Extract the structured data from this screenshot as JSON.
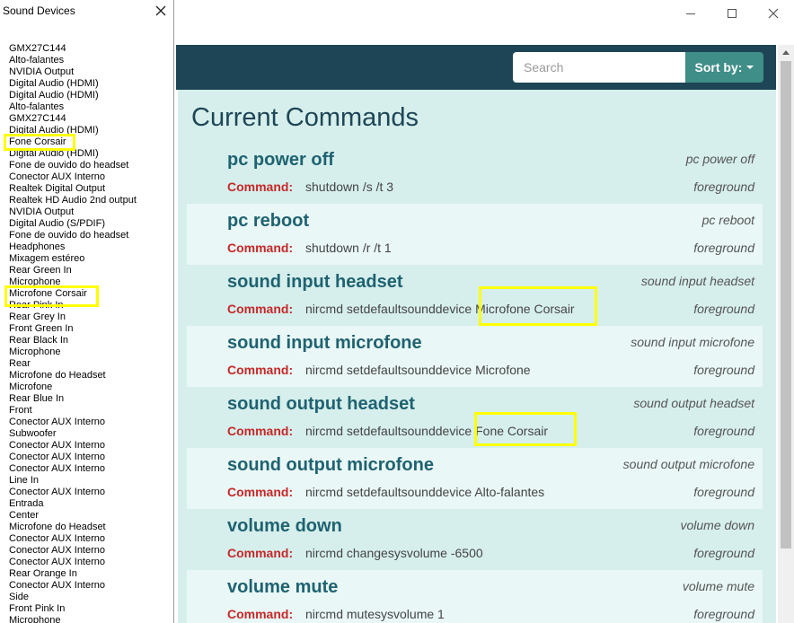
{
  "sound_panel": {
    "title": "Sound Devices",
    "devices": [
      "GMX27C144",
      "Alto-falantes",
      "NVIDIA Output",
      "Digital Audio (HDMI)",
      "Digital Audio (HDMI)",
      "Alto-falantes",
      "GMX27C144",
      "Digital Audio (HDMI)",
      "Fone Corsair",
      "Digital Audio (HDMI)",
      "Fone de ouvido do headset",
      "Conector AUX Interno",
      "Realtek Digital Output",
      "Realtek HD Audio 2nd output",
      "NVIDIA Output",
      "Digital Audio (S/PDIF)",
      "Fone de ouvido do headset",
      "Headphones",
      "Mixagem estéreo",
      "Rear Green In",
      "Microphone",
      "Microfone Corsair",
      "Rear Pink In",
      "Rear Grey In",
      "Front Green In",
      "Rear Black In",
      "Microphone",
      "Rear",
      "Microfone do Headset",
      "Microfone",
      "Rear Blue In",
      "Front",
      "Conector AUX Interno",
      "Subwoofer",
      "Conector AUX Interno",
      "Conector AUX Interno",
      "Conector AUX Interno",
      "Line In",
      "Conector AUX Interno",
      "Entrada",
      "Center",
      "Microfone do Headset",
      "Conector AUX Interno",
      "Conector AUX Interno",
      "Conector AUX Interno",
      "Rear Orange In",
      "Conector AUX Interno",
      "Side",
      "Front Pink In",
      "Microphone"
    ]
  },
  "search": {
    "placeholder": "Search",
    "value": ""
  },
  "sort": {
    "label": "Sort by:"
  },
  "page": {
    "title": "Current Commands"
  },
  "command_label": "Command:",
  "commands": [
    {
      "title": "pc power off",
      "voice": "pc power off",
      "command": "shutdown /s /t 3",
      "mode": "foreground"
    },
    {
      "title": "pc reboot",
      "voice": "pc reboot",
      "command": "shutdown /r /t 1",
      "mode": "foreground"
    },
    {
      "title": "sound input headset",
      "voice": "sound input headset",
      "command": "nircmd setdefaultsounddevice Microfone Corsair",
      "mode": "foreground"
    },
    {
      "title": "sound input microfone",
      "voice": "sound input microfone",
      "command": "nircmd setdefaultsounddevice Microfone",
      "mode": "foreground"
    },
    {
      "title": "sound output headset",
      "voice": "sound output headset",
      "command": "nircmd setdefaultsounddevice Fone Corsair",
      "mode": "foreground"
    },
    {
      "title": "sound output microfone",
      "voice": "sound output microfone",
      "command": "nircmd setdefaultsounddevice Alto-falantes",
      "mode": "foreground"
    },
    {
      "title": "volume down",
      "voice": "volume down",
      "command": "nircmd changesysvolume -6500",
      "mode": "foreground"
    },
    {
      "title": "volume mute",
      "voice": "volume mute",
      "command": "nircmd mutesysvolume 1",
      "mode": "foreground"
    }
  ],
  "colors": {
    "navbar": "#1e4555",
    "accent": "#3f8e88",
    "content_bg": "#d6efed",
    "command_title": "#1f6270",
    "command_label": "#c62828",
    "highlight": "#ffff00"
  },
  "icons": {
    "close": "close-icon",
    "minimize": "minimize-icon",
    "maximize": "maximize-icon",
    "sort_caret": "chevron-down-icon"
  }
}
